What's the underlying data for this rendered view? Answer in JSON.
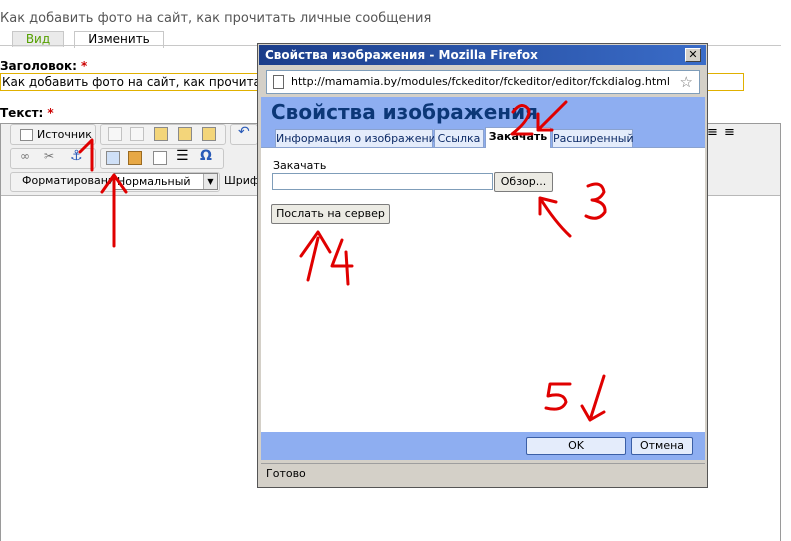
{
  "page": {
    "title": "Как добавить фото на сайт, как прочитать личные сообщения",
    "tabs": [
      {
        "label": "Вид"
      },
      {
        "label": "Изменить"
      }
    ],
    "heading_label": "Заголовок:",
    "heading_value": "Как добавить фото на сайт, как прочитать",
    "text_label": "Текст:",
    "required_mark": "*"
  },
  "editor": {
    "source_button": "Источник",
    "format_label": "Форматирование",
    "format_value": "Нормальный",
    "font_label": "Шрифт"
  },
  "dialog": {
    "window_title": "Свойства изображения - Mozilla Firefox",
    "close_glyph": "✕",
    "url": "http://mamamia.by/modules/fckeditor/fckeditor/editor/fckdialog.html",
    "heading": "Свойства изображения",
    "tabs": [
      {
        "label": "Информация о изображении"
      },
      {
        "label": "Ссылка"
      },
      {
        "label": "Закачать"
      },
      {
        "label": "Расширенный"
      }
    ],
    "upload_label": "Закачать",
    "browse_button": "Обзор...",
    "send_button": "Послать на сервер",
    "ok_button": "OK",
    "cancel_button": "Отмена",
    "status": "Готово"
  },
  "annotations": [
    "1",
    "2",
    "3",
    "4",
    "5"
  ],
  "colors": {
    "dialog_header": "#8eaef1",
    "title_bar": "#1b3d8a",
    "annotation": "#e00000"
  }
}
